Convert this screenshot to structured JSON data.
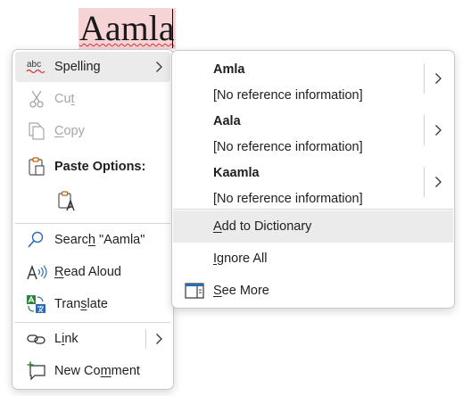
{
  "document": {
    "misspelled_word": "Aamla"
  },
  "context_menu": {
    "spelling": {
      "icon_text": "abc",
      "label": "Spelling"
    },
    "cut": {
      "pre": "Cu",
      "key": "t",
      "post": ""
    },
    "copy": {
      "pre": "",
      "key": "C",
      "post": "opy"
    },
    "paste_options": {
      "label": "Paste Options:"
    },
    "search": {
      "pre": "Searc",
      "key": "h",
      "post": " \"Aamla\""
    },
    "read_aloud": {
      "pre": "",
      "key": "R",
      "post": "ead Aloud"
    },
    "translate": {
      "pre": "Tran",
      "key": "s",
      "post": "late"
    },
    "link": {
      "pre": "L",
      "key": "i",
      "post": "nk"
    },
    "new_comment": {
      "pre": "New Co",
      "key": "m",
      "post": "ment"
    }
  },
  "spelling_submenu": {
    "suggestions": [
      {
        "word": "Amla",
        "info": "[No reference information]"
      },
      {
        "word": "Aala",
        "info": "[No reference information]"
      },
      {
        "word": "Kaamla",
        "info": "[No reference information]"
      }
    ],
    "add_to_dictionary": {
      "pre": "",
      "key": "A",
      "post": "dd to Dictionary"
    },
    "ignore_all": {
      "pre": "",
      "key": "I",
      "post": "gnore All"
    },
    "see_more": {
      "pre": "",
      "key": "S",
      "post": "ee More"
    }
  },
  "colors": {
    "misspelling_highlight": "#f6d4d6",
    "squiggle": "#d13438",
    "hover": "#ebebeb",
    "icon_blue": "#2b6cb0",
    "icon_green": "#2e8540",
    "icon_orange": "#c2620a"
  }
}
